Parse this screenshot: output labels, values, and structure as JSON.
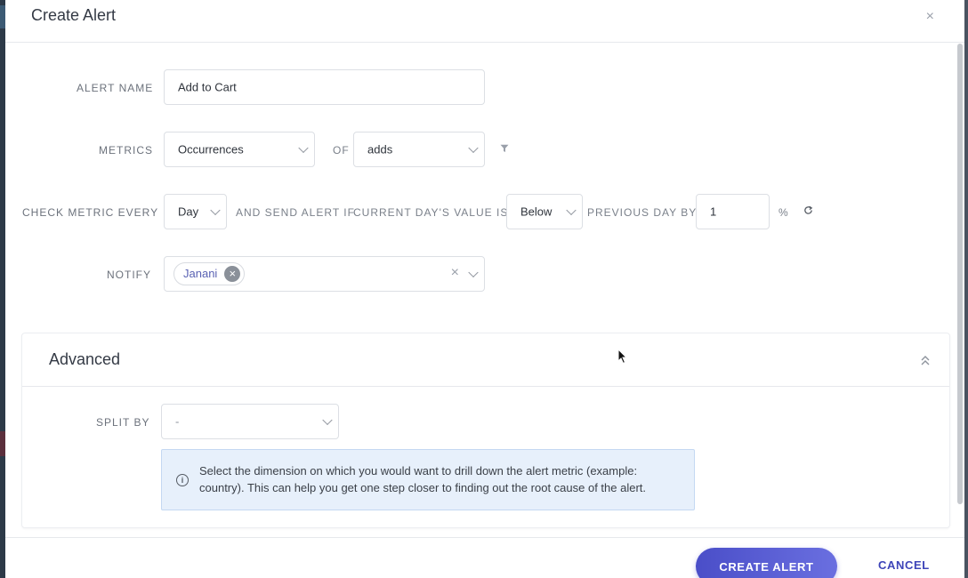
{
  "modal": {
    "title": "Create Alert",
    "close_glyph": "×"
  },
  "form": {
    "alert_name": {
      "label": "ALERT NAME",
      "value": "Add to Cart"
    },
    "metrics": {
      "label": "METRICS",
      "value": "Occurrences",
      "of_label": "OF",
      "of_value": "adds"
    },
    "check": {
      "label": "CHECK METRIC EVERY",
      "period": "Day",
      "send_label": "AND SEND ALERT IF",
      "current_label": "CURRENT DAY'S VALUE IS",
      "direction": "Below",
      "previous_label": "PREVIOUS DAY BY",
      "amount": "1",
      "unit": "%"
    },
    "notify": {
      "label": "NOTIFY",
      "chips": [
        "Janani"
      ],
      "clear_glyph": "×",
      "chip_remove_glyph": "×"
    }
  },
  "advanced": {
    "title": "Advanced",
    "split_by": {
      "label": "SPLIT BY",
      "value": "-"
    },
    "info": "Select the dimension on which you would want to drill down the alert metric (example: country). This can help you get one step closer to finding out the root cause of the alert.",
    "info_icon": "i"
  },
  "footer": {
    "create_label": "CREATE ALERT",
    "cancel_label": "CANCEL"
  },
  "colors": {
    "primary": "#4a4ec8",
    "link": "#3d44b8",
    "info_bg": "#e7f0fb"
  }
}
